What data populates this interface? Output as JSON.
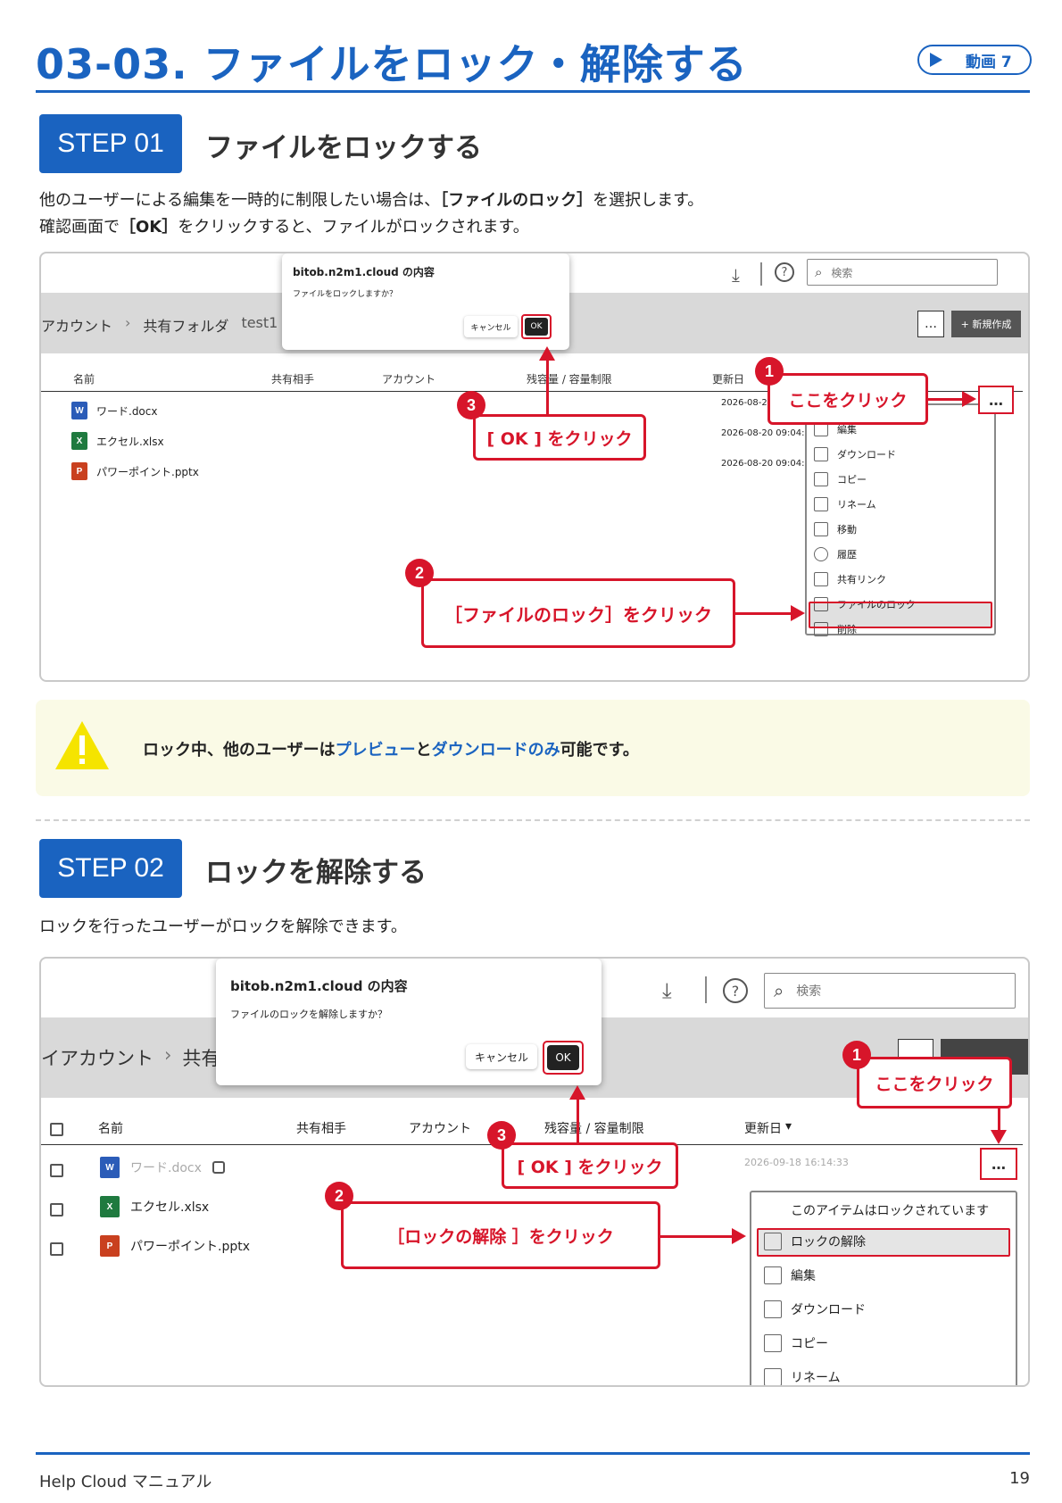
{
  "header": {
    "title": "03-03. ファイルをロック・解除する",
    "video_badge": "動画 7"
  },
  "step1": {
    "badge": "STEP 01",
    "title": "ファイルをロックする",
    "desc_line1_pre": "他のユーザーによる編集を一時的に制限したい場合は、",
    "desc_line1_bold": "［ファイルのロック］",
    "desc_line1_post": "を選択します。",
    "desc_line2_pre": "確認画面で",
    "desc_line2_bold": "［OK］",
    "desc_line2_post": "をクリックすると、ファイルがロックされます。",
    "screenshot": {
      "toolbar_search_placeholder": "検索",
      "breadcrumb": [
        "アカウント",
        "共有フォルダ",
        "test1"
      ],
      "new_button": "+ 新規作成",
      "more_button": "…",
      "columns": [
        "名前",
        "共有相手",
        "アカウント",
        "残容量 / 容量制限",
        "更新日"
      ],
      "files": [
        {
          "name": "ワード.docx",
          "type": "W",
          "date": "2026-08-2"
        },
        {
          "name": "エクセル.xlsx",
          "type": "X",
          "date": "2026-08-20 09:04:5"
        },
        {
          "name": "パワーポイント.pptx",
          "type": "P",
          "date": "2026-08-20 09:04:5"
        }
      ],
      "dialog": {
        "title": "bitob.n2m1.cloud の内容",
        "message": "ファイルをロックしますか？",
        "cancel": "キャンセル",
        "ok": "OK"
      },
      "menu": [
        "編集",
        "ダウンロード",
        "コピー",
        "リネーム",
        "移動",
        "履歴",
        "共有リンク",
        "ファイルのロック",
        "削除"
      ],
      "callouts": {
        "c1_num": "1",
        "c1_text": "ここをクリック",
        "c2_num": "2",
        "c2_text": "［ファイルのロック］をクリック",
        "c3_num": "3",
        "c3_text": "[ OK ] をクリック"
      }
    }
  },
  "note": {
    "pre": "ロック中、他のユーザーは",
    "preview": "プレビュー",
    "mid": "と",
    "download": "ダウンロードのみ",
    "post": "可能です。"
  },
  "step2": {
    "badge": "STEP 02",
    "title": "ロックを解除する",
    "desc": "ロックを行ったユーザーがロックを解除できます。",
    "screenshot": {
      "toolbar_search_placeholder": "検索",
      "breadcrumb": [
        "イアカウント",
        "共有"
      ],
      "columns": [
        "名前",
        "共有相手",
        "アカウント",
        "残容量 / 容量制限",
        "更新日"
      ],
      "files": [
        {
          "name": "ワード.docx",
          "type": "W",
          "date": "2026-09-18 16:14:33"
        },
        {
          "name": "エクセル.xlsx",
          "type": "X",
          "date": ""
        },
        {
          "name": "パワーポイント.pptx",
          "type": "P",
          "date": ""
        }
      ],
      "dialog": {
        "title": "bitob.n2m1.cloud の内容",
        "message": "ファイルのロックを解除しますか？",
        "cancel": "キャンセル",
        "ok": "OK"
      },
      "menu_header": "このアイテムはロックされています",
      "menu": [
        "ロックの解除",
        "編集",
        "ダウンロード",
        "コピー",
        "リネーム"
      ],
      "more_button": "…",
      "callouts": {
        "c1_num": "1",
        "c1_text": "ここをクリック",
        "c2_num": "2",
        "c2_text": "［ロックの解除 ］をクリック",
        "c3_num": "3",
        "c3_text": "[ OK ] をクリック"
      }
    }
  },
  "footer": {
    "left": "Help Cloud マニュアル",
    "page": "19"
  }
}
